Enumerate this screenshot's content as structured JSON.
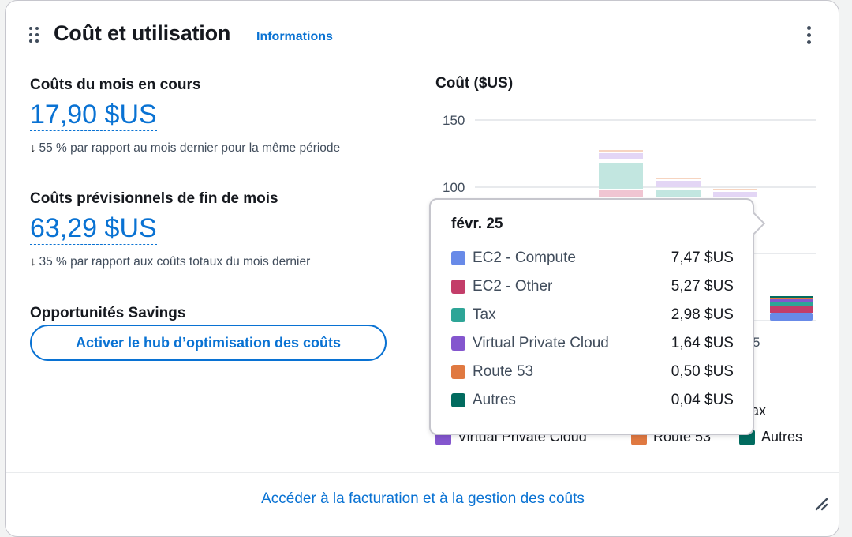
{
  "widget": {
    "title": "Coût et utilisation",
    "info_link": "Informations"
  },
  "current_month": {
    "label": "Coûts du mois en cours",
    "value": "17,90 $US",
    "arrow": "↓",
    "comparison": "55 % par rapport au mois dernier pour la même période"
  },
  "forecast": {
    "label": "Coûts prévisionnels de fin de mois",
    "value": "63,29 $US",
    "arrow": "↓",
    "comparison": "35 % par rapport aux coûts totaux du mois dernier"
  },
  "savings": {
    "label": "Opportunités Savings",
    "button": "Activer le hub d’optimisation des coûts"
  },
  "chart_data": {
    "type": "bar",
    "stacked": true,
    "title": "Coût ($US)",
    "y_ticks": [
      "150",
      "100"
    ],
    "ylim": [
      0,
      150
    ],
    "grid": true,
    "x_fragment_visible": "5",
    "series_colors": {
      "EC2 - Compute": "#688ae8",
      "EC2 - Other": "#c33d69",
      "Tax": "#2ea597",
      "Virtual Private Cloud": "#8456ce",
      "Route 53": "#e07941",
      "Autres": "#016b5f"
    },
    "visible_bar_tops": [
      {
        "tax": 34,
        "vpc": 4,
        "route53": 1.3,
        "other": 0.6,
        "ec2_other": 4,
        "total_approx": 126
      },
      {
        "tax": 5,
        "vpc": 5,
        "route53": 1,
        "ec2_other": 3,
        "total_approx": 106
      },
      {
        "vpc": 4,
        "route53": 1,
        "ec2_other": 3,
        "total_approx": 97
      },
      {
        "ec2_compute": 7.47,
        "ec2_other": 5.27,
        "tax": 2.98,
        "vpc": 1.64,
        "route53": 0.5,
        "autres": 0.04
      }
    ],
    "legend_fragment_visible": "ax"
  },
  "legend": [
    {
      "label": "Virtual Private Cloud",
      "color": "#8456ce"
    },
    {
      "label": "Route 53",
      "color": "#e07941"
    },
    {
      "label": "Autres",
      "color": "#016b5f"
    }
  ],
  "tooltip": {
    "title": "févr. 25",
    "rows": [
      {
        "label": "EC2 - Compute",
        "value": "7,47 $US",
        "color": "#688ae8"
      },
      {
        "label": "EC2 - Other",
        "value": "5,27 $US",
        "color": "#c33d69"
      },
      {
        "label": "Tax",
        "value": "2,98 $US",
        "color": "#2ea597"
      },
      {
        "label": "Virtual Private Cloud",
        "value": "1,64 $US",
        "color": "#8456ce"
      },
      {
        "label": "Route 53",
        "value": "0,50 $US",
        "color": "#e07941"
      },
      {
        "label": "Autres",
        "value": "0,04 $US",
        "color": "#016b5f"
      }
    ]
  },
  "footer": {
    "link": "Accéder à la facturation et à la gestion des coûts"
  }
}
